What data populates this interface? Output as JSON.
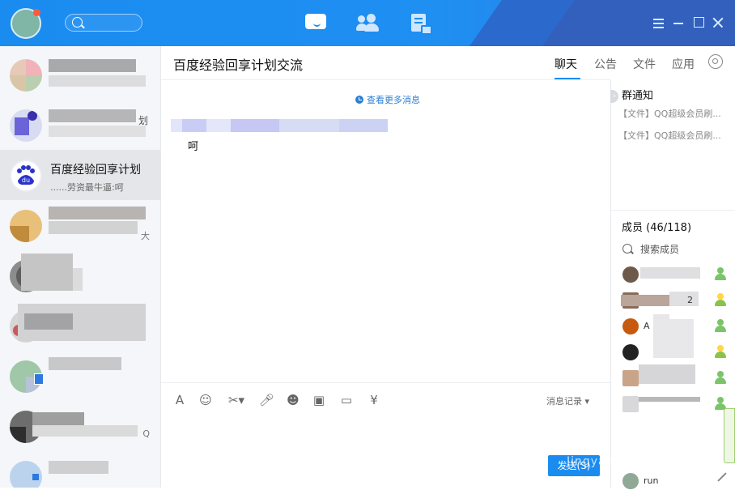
{
  "topbar": {
    "icons": [
      "user-avatar",
      "search-icon",
      "chat-icon",
      "contacts-icon",
      "space-icon",
      "menu-icon",
      "minimize-icon",
      "maximize-icon",
      "close-icon"
    ],
    "colors": {
      "bar": "#1a8cf0",
      "notify_dot": "#ff5a3c"
    }
  },
  "sidebar": {
    "selected": {
      "name": "百度经验回享计划",
      "preview": "......劳资最牛逼:呵"
    },
    "row_tails": {
      "row2_pin": "划",
      "row4_tail": "大",
      "row8_tail": "Q"
    }
  },
  "chat": {
    "title": "百度经验回享计划交流",
    "tabs": [
      "聊天",
      "公告",
      "文件",
      "应用"
    ],
    "active_tab": "聊天",
    "more_messages": "查看更多消息",
    "message_text": "呵",
    "history_label": "消息记录",
    "send_label": "发送(S)",
    "toolbar_icons": [
      "font-icon",
      "emoji-icon",
      "screenshot-icon",
      "voice-icon",
      "sticker-icon",
      "image-icon",
      "folder-icon",
      "red-packet-icon"
    ]
  },
  "right_panel": {
    "notice_title": "群通知",
    "notices": [
      "【文件】QQ超级会员刷...",
      "【文件】QQ超级会员刷..."
    ],
    "members_title": "成员 (46/118)",
    "members_search": "搜索成员",
    "members": [
      {
        "name": "",
        "role": "member"
      },
      {
        "name": "2",
        "role": "admin"
      },
      {
        "name": "A",
        "role": "member"
      },
      {
        "name": "",
        "role": "admin"
      },
      {
        "name": "",
        "role": "member"
      },
      {
        "name": "",
        "role": "member"
      },
      {
        "name": "run",
        "role": "member"
      }
    ]
  },
  "watermark": "Jingyan.baidu.com"
}
